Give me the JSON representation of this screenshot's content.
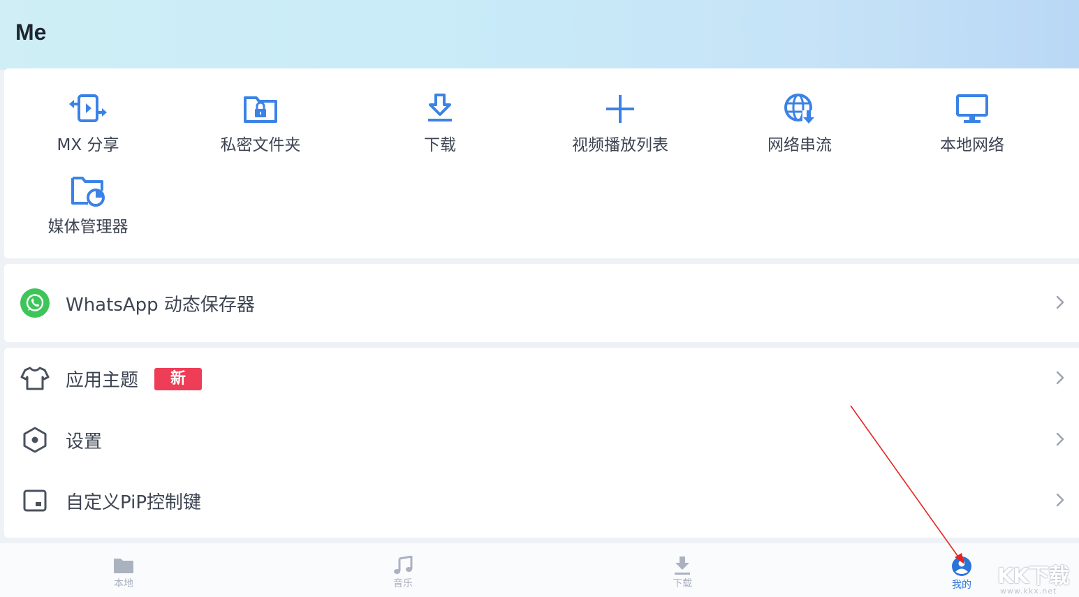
{
  "header": {
    "title": "Me"
  },
  "tools": [
    {
      "label": "MX 分享",
      "icon": "share-transfer-icon"
    },
    {
      "label": "私密文件夹",
      "icon": "locked-folder-icon"
    },
    {
      "label": "下载",
      "icon": "download-icon"
    },
    {
      "label": "视频播放列表",
      "icon": "plus-icon"
    },
    {
      "label": "网络串流",
      "icon": "globe-download-icon"
    },
    {
      "label": "本地网络",
      "icon": "monitor-icon"
    },
    {
      "label": "媒体管理器",
      "icon": "folder-chart-icon"
    }
  ],
  "whatsapp": {
    "label": "WhatsApp 动态保存器",
    "icon": "whatsapp-icon"
  },
  "menu": [
    {
      "label": "应用主题",
      "badge": "新",
      "icon": "tshirt-icon"
    },
    {
      "label": "设置",
      "icon": "settings-hexagon-icon"
    },
    {
      "label": "自定义PiP控制键",
      "icon": "pip-icon"
    }
  ],
  "bottom_nav": [
    {
      "label": "本地",
      "icon": "folder-icon",
      "active": false
    },
    {
      "label": "音乐",
      "icon": "music-note-icon",
      "active": false
    },
    {
      "label": "下载",
      "icon": "download-icon",
      "active": false
    },
    {
      "label": "我的",
      "icon": "profile-icon",
      "active": true
    }
  ],
  "watermark": {
    "text": "KK下载",
    "url": "www.kkx.net"
  },
  "colors": {
    "accent": "#2b74d8",
    "icon_blue": "#3b82e6",
    "badge_red": "#ee3d57",
    "whatsapp_green": "#3ec55a",
    "annotation_arrow": "#e8231f"
  }
}
